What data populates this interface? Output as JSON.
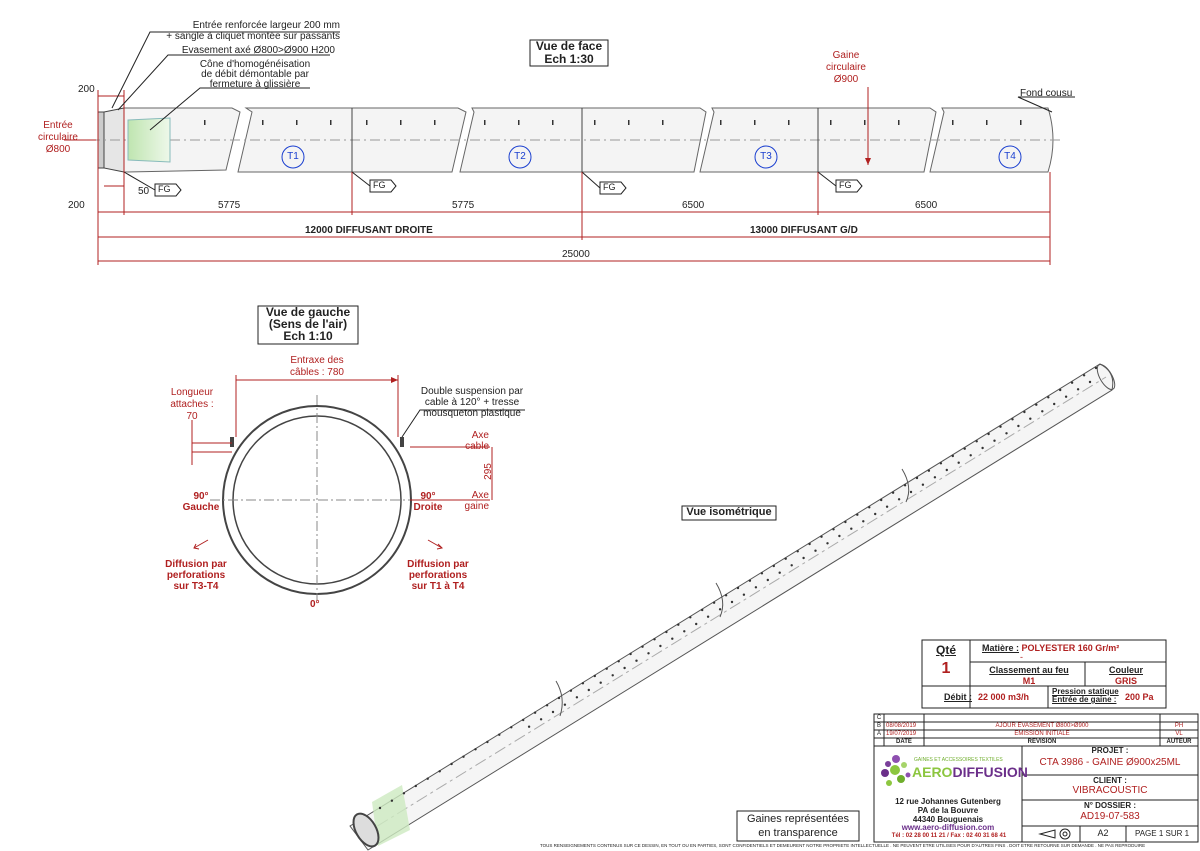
{
  "front_view": {
    "title": "Vue de face",
    "scale": "Ech 1:30",
    "note_inlet_reinforced": "Entrée renforcée largeur 200 mm",
    "note_strap": "+ sangle à cliquet montée sur passants",
    "note_flare": "Evasement axé Ø800>Ø900 H200",
    "note_cone_1": "Cône d'homogénéisation",
    "note_cone_2": "de débit démontable par",
    "note_cone_3": "fermeture à glissière",
    "inlet_label_1": "Entrée",
    "inlet_label_2": "circulaire",
    "inlet_label_3": "Ø800",
    "duct_label_1": "Gaine",
    "duct_label_2": "circulaire",
    "duct_label_3": "Ø900",
    "end_label": "Fond cousu",
    "dim_200_top": "200",
    "dim_50": "50",
    "dim_200": "200",
    "dim_5775_a": "5775",
    "dim_5775_b": "5775",
    "dim_6500_a": "6500",
    "dim_6500_b": "6500",
    "dim_12000": "12000 DIFFUSANT DROITE",
    "dim_13000": "13000 DIFFUSANT G/D",
    "dim_25000": "25000",
    "sections": [
      "T1",
      "T2",
      "T3",
      "T4"
    ],
    "fg_label": "FG"
  },
  "left_view": {
    "title_1": "Vue de gauche",
    "title_2": "(Sens de l'air)",
    "title_3": "Ech 1:10",
    "cable_spacing_1": "Entraxe des",
    "cable_spacing_2": "câbles : 780",
    "attach_1": "Longueur",
    "attach_2": "attaches :",
    "attach_3": "70",
    "suspension_1": "Double suspension par",
    "suspension_2": "cable à 120° + tresse",
    "suspension_3": "mousqueton plastique",
    "axe_cable_1": "Axe",
    "axe_cable_2": "cable",
    "axe_gaine_1": "Axe",
    "axe_gaine_2": "gaine",
    "dim_295": "295",
    "left_angle_1": "90°",
    "left_angle_2": "Gauche",
    "right_angle_1": "90°",
    "right_angle_2": "Droite",
    "bottom_angle": "0°",
    "diff_left_1": "Diffusion par",
    "diff_left_2": "perforations",
    "diff_left_3": "sur T3-T4",
    "diff_right_1": "Diffusion par",
    "diff_right_2": "perforations",
    "diff_right_3": "sur T1 à T4"
  },
  "iso_view": {
    "title": "Vue isométrique",
    "note_1": "Gaines représentées",
    "note_2": "en transparence"
  },
  "spec": {
    "qty_label": "Qté",
    "qty": "1",
    "material_label": "Matière :",
    "material": "POLYESTER 160 Gr/m²",
    "dash": "-",
    "fire_label": "Classement au feu",
    "fire": "M1",
    "color_label": "Couleur",
    "color": "GRIS",
    "flow_label": "Débit :",
    "flow": "22 000 m3/h",
    "pressure_label_1": "Pression statique",
    "pressure_label_2": "Entrée de gaine :",
    "pressure": "200 Pa"
  },
  "revisions": {
    "rows": [
      {
        "rev": "C",
        "date": "",
        "text": "",
        "author": ""
      },
      {
        "rev": "B",
        "date": "08/08/2019",
        "text": "AJOUR EVASEMENT Ø800>Ø900",
        "author": "PH"
      },
      {
        "rev": "A",
        "date": "19/07/2019",
        "text": "EMISSION INITIALE",
        "author": "VL"
      }
    ],
    "header_date": "DATE",
    "header_rev": "REVISION",
    "header_author": "AUTEUR"
  },
  "company": {
    "tagline": "GAINES ET ACCESSOIRES TEXTILES",
    "name_a": "AERO",
    "name_b": "DIFFUSION",
    "address_1": "12 rue Johannes Gutenberg",
    "address_2": "PA de la Bouvre",
    "address_3": "44340 Bouguenais",
    "web": "www.aero-diffusion.com",
    "phone": "Tél : 02 28 00 11 21 / Fax : 02 40 31 68 41"
  },
  "title_block": {
    "project_label": "PROJET :",
    "project": "CTA 3986 - GAINE Ø900x25ML",
    "client_label": "CLIENT :",
    "client": "VIBRACOUSTIC",
    "dossier_label": "N° DOSSIER :",
    "dossier": "AD19-07-583",
    "format": "A2",
    "page": "PAGE 1 SUR 1"
  },
  "footer": "TOUS RENSEIGNEMENTS CONTENUS SUR CE DESSIN, EN TOUT OU EN PARTIES, SONT CONFIDENTIELS ET DEMEURENT NOTRE PROPRIETE INTELLECTUELLE . NE PEUVENT ETRE UTILISES POUR D'AUTRES FINS . DOIT ETRE RETOURNE SUR DEMANDE . NE PAS REPRODUIRE"
}
